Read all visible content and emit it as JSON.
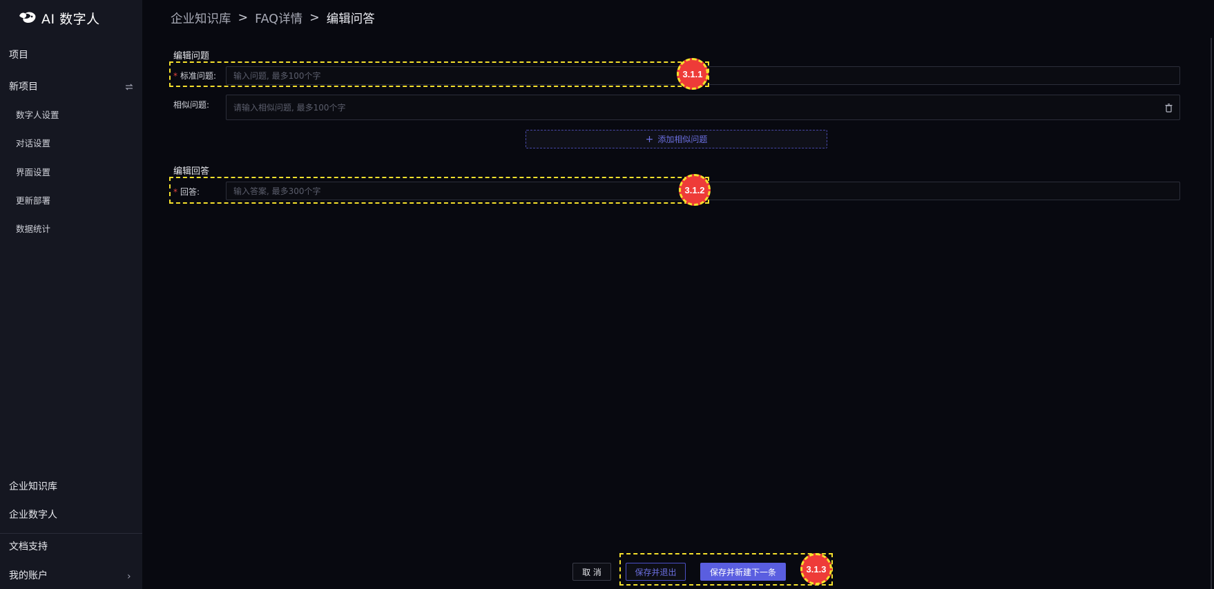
{
  "app": {
    "title": "AI 数字人"
  },
  "sidebar": {
    "project_label": "项目",
    "new_project_label": "新项目",
    "sub_items": [
      {
        "label": "数字人设置"
      },
      {
        "label": "对话设置"
      },
      {
        "label": "界面设置"
      },
      {
        "label": "更新部署"
      },
      {
        "label": "数据统计"
      }
    ],
    "bottom_items": [
      {
        "label": "企业知识库"
      },
      {
        "label": "企业数字人"
      }
    ],
    "docs_label": "文档支持",
    "account_label": "我的账户",
    "account_chevron": "›"
  },
  "breadcrumb": {
    "items": [
      "企业知识库",
      "FAQ详情",
      "编辑问答"
    ],
    "separator": ">"
  },
  "form": {
    "question_section_title": "编辑问题",
    "standard_question_label": "标准问题:",
    "standard_question_placeholder": "输入问题, 最多100个字",
    "similar_question_label": "相似问题:",
    "similar_question_placeholder": "请输入相似问题, 最多100个字",
    "add_similar_plus": "+",
    "add_similar_label": "添加相似问题",
    "answer_section_title": "编辑回答",
    "answer_label": "回答:",
    "answer_placeholder": "输入答案, 最多300个字",
    "required_mark": "*"
  },
  "footer": {
    "cancel_label": "取 消",
    "save_exit_label": "保存并退出",
    "save_new_label": "保存并新建下一条"
  },
  "annotations": [
    "3.1.1",
    "3.1.2",
    "3.1.3"
  ],
  "colors": {
    "background": "#080910",
    "sidebar": "#151721",
    "accent": "#5a5ee0",
    "annotation_fill": "#ee3b38",
    "annotation_border": "#f6e12c",
    "required": "#e0453f"
  },
  "icons": [
    "logo-icon",
    "swap-icon",
    "trash-icon",
    "plus-icon",
    "chevron-right-icon"
  ]
}
